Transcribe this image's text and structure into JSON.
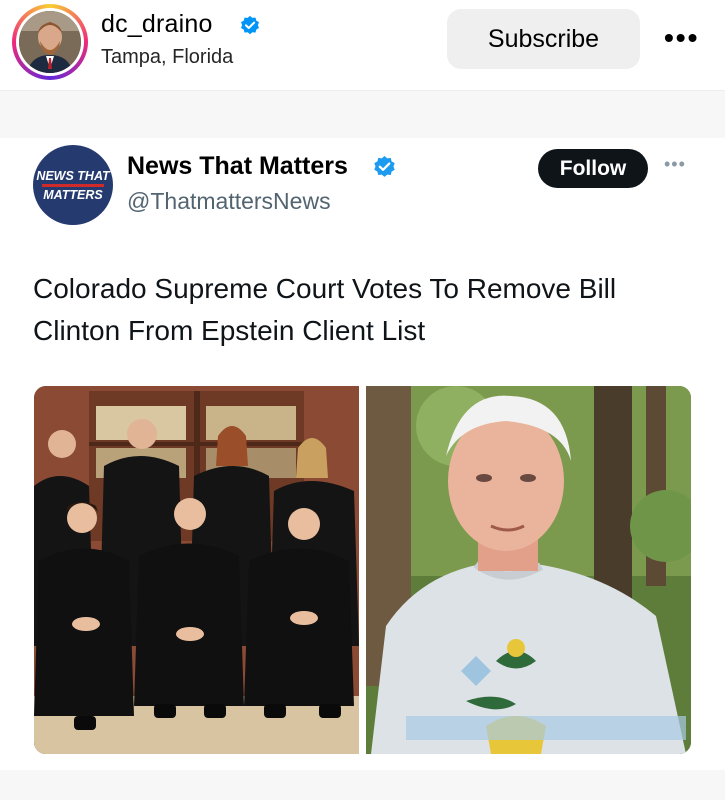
{
  "post_header": {
    "username": "dc_draino",
    "location": "Tampa, Florida",
    "subscribe_label": "Subscribe",
    "more_label": "•••",
    "verified_icon": "verified-badge-icon",
    "accent_color": "#0095f6"
  },
  "tweet": {
    "logo_text_top": "NEWS THAT",
    "logo_text_bottom": "MATTERS",
    "account_name": "News That Matters",
    "handle": "@ThatmattersNews",
    "follow_label": "Follow",
    "more_label": "•••",
    "headline": "Colorado Supreme Court Votes To Remove Bill Clinton From Epstein Client List",
    "verified_color": "#1d9bf0"
  },
  "images": [
    {
      "subject": "group-photo-of-judges-in-robes"
    },
    {
      "subject": "portrait-of-man-in-sweater-outdoors"
    }
  ]
}
